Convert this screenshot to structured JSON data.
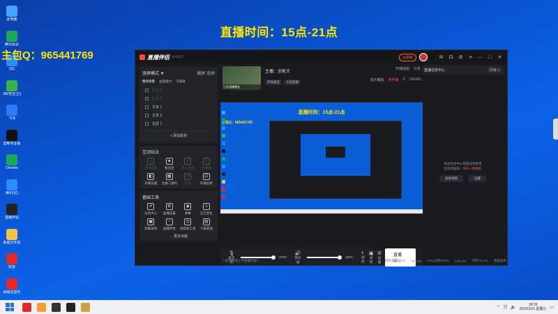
{
  "banner": {
    "title": "直播时间：15点-21点",
    "qq": "主包Q：965441769"
  },
  "desktop_icons": [
    {
      "label": "此电脑",
      "color": "#4aa3ff"
    },
    {
      "label": "腾讯会议",
      "color": "#1aa760"
    },
    {
      "label": "QQ",
      "color": "#2b8cff"
    },
    {
      "label": "360安全卫士",
      "color": "#38b34a"
    },
    {
      "label": "飞书",
      "color": "#2f7bf5"
    },
    {
      "label": "剪映专业版",
      "color": "#111111"
    },
    {
      "label": "Chrome",
      "color": "#1aa760"
    },
    {
      "label": "腾讯QQ",
      "color": "#2b8cff"
    },
    {
      "label": "直播伴侣",
      "color": "#222222"
    },
    {
      "label": "新建文件夹",
      "color": "#f2c14e"
    },
    {
      "label": "抖音",
      "color": "#e22a2a"
    },
    {
      "label": "网易云音乐",
      "color": "#e22a2a"
    }
  ],
  "app": {
    "name": "直播伴侣",
    "version": "6.4.5.1",
    "record_btn": "云录制"
  },
  "left": {
    "mode": "竖屏模式 ▼",
    "mode_right": "横屏",
    "mode_right2": "竖屏",
    "tabs": [
      "我的场景",
      "画面素材",
      "可编辑"
    ],
    "sources": [
      {
        "label": "文本 4",
        "dim": true
      },
      {
        "label": "文本 2",
        "dim": true
      },
      {
        "label": "文本 1",
        "dim": false
      },
      {
        "label": "文本 3",
        "dim": false
      },
      {
        "label": "全屏 1",
        "dim": false
      }
    ],
    "add_source": "+ 添加素材",
    "interact_title": "互动玩法",
    "interact_items": [
      {
        "label": "连线连麦",
        "icon": "♫",
        "dim": true
      },
      {
        "label": "粉丝团",
        "icon": "◈",
        "dim": false
      },
      {
        "label": "多人连线",
        "icon": "⇄",
        "dim": true
      },
      {
        "label": "PK连线",
        "icon": "⚇",
        "dim": true
      },
      {
        "label": "开播设置",
        "icon": "◧",
        "dim": false
      },
      {
        "label": "主播二维码",
        "icon": "▦",
        "dim": false
      },
      {
        "label": "红包",
        "icon": "◫",
        "dim": true
      },
      {
        "label": "开播必看",
        "icon": "☑",
        "dim": false
      }
    ],
    "tools_title": "基础工具",
    "tool_items": [
      {
        "label": "任务中心",
        "icon": "✔"
      },
      {
        "label": "直播设置",
        "icon": "⚙"
      },
      {
        "label": "弹幕",
        "icon": "◉"
      },
      {
        "label": "正在发生",
        "icon": "⇩"
      },
      {
        "label": "屏幕录制",
        "icon": "▣"
      },
      {
        "label": "直播伴侣",
        "icon": "◔"
      },
      {
        "label": "短视频工具",
        "icon": "◎"
      },
      {
        "label": "下载管理",
        "icon": "▤"
      }
    ],
    "more": "··· 更多功能"
  },
  "stream": {
    "thumb_caption": "已开直播预告",
    "title": "主播：全能王",
    "tags": [
      "其他类型",
      "大屏直播"
    ],
    "right_top": [
      "开播体验",
      "分享"
    ],
    "right_bottom": [
      "音乐播放",
      "未开播",
      "4",
      "134169"
    ]
  },
  "preview": {
    "title": "直播时间：15点-21点",
    "qq": "主包Q：965441769"
  },
  "controls": {
    "mic_label": "麦克风",
    "mic_pct": "100%",
    "speaker_label": "扬声器",
    "speaker_pct": "100%",
    "btn1": "画质",
    "btn2": "录制",
    "btn3": "设置",
    "go_live": "直播中..."
  },
  "status": {
    "hint": "□ 如何快速上手直播伴侣?",
    "items": [
      "网络状态0Kb/s",
      "FPS:60",
      "CPU占用0.00%",
      "CPU:4%",
      "内存:41.2%",
      "性能良好"
    ]
  },
  "right": {
    "title": "直播任务中心",
    "tag": "评级 >",
    "msg_line1": "体验任务中心完成任务获得",
    "msg_line2_a": "任务奖励前，",
    "msg_line2_b": "请先一键领取",
    "btn1": "前往领取",
    "btn2": "设置"
  },
  "taskbar": {
    "apps": [
      "#e22a2a",
      "#f0a030",
      "#333333",
      "#222222",
      "#caa14a"
    ],
    "time": "18:29",
    "date": "2023/3/15 星期三"
  }
}
